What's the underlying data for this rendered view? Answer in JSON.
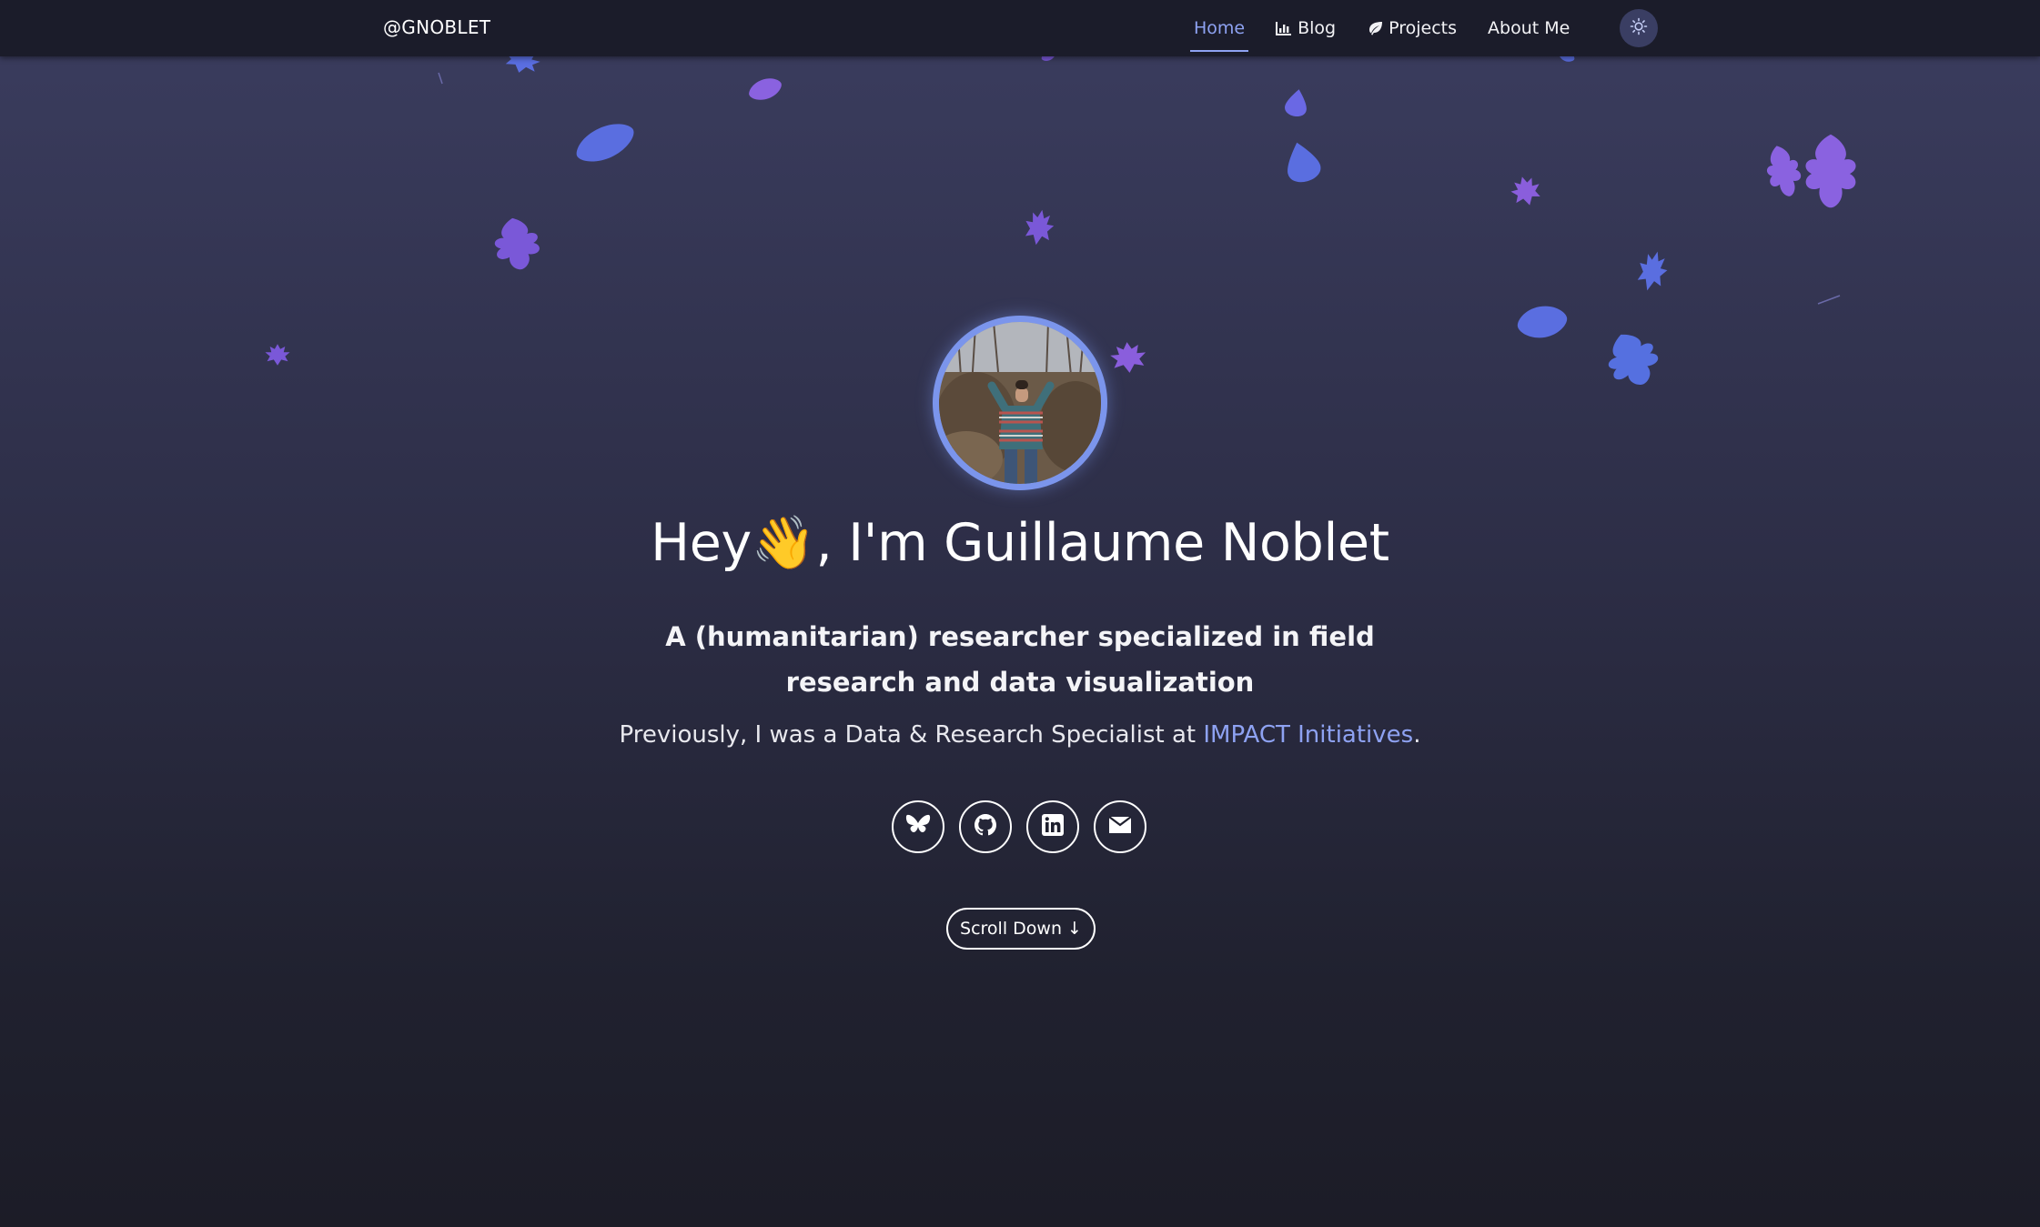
{
  "navbar": {
    "brand": "@GNOBLET",
    "items": [
      {
        "label": "Home",
        "icon": "",
        "active": true
      },
      {
        "label": "Blog",
        "icon": "chart-bar-icon",
        "active": false
      },
      {
        "label": "Projects",
        "icon": "leaf-icon",
        "active": false
      },
      {
        "label": "About Me",
        "icon": "",
        "active": false
      }
    ],
    "theme_toggle_icon": "sun-icon"
  },
  "hero": {
    "avatar_alt": "Profile photo",
    "title_before": "Hey",
    "emoji": "👋",
    "title_after": ", I'm Guillaume Noblet",
    "subtitle": "A (humanitarian) researcher specialized in field research and data visualization",
    "prev_text": "Previously, I was a Data & Research Specialist at ",
    "prev_link": "IMPACT Initiatives",
    "prev_end": ".",
    "socials": [
      "bluesky-icon",
      "github-icon",
      "linkedin-icon",
      "email-icon"
    ],
    "scroll_label": "Scroll Down ↓"
  },
  "colors": {
    "accent": "#8ea2f2",
    "leaf_purple": "#7c5ce0",
    "leaf_blue": "#5470e0",
    "navbar_bg": "#1b1c2a"
  }
}
